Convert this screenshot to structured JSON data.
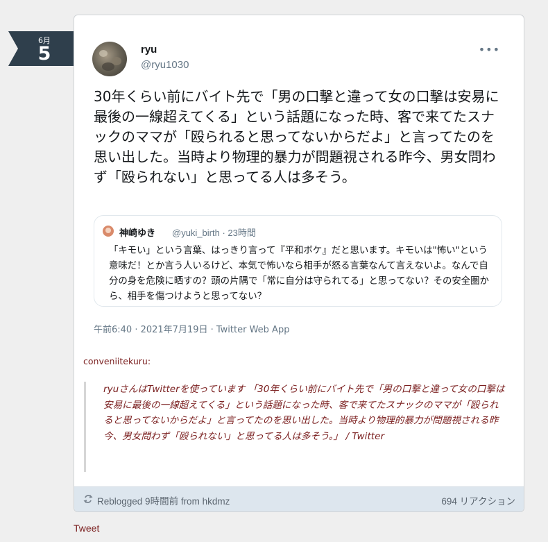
{
  "date": {
    "month": "6月",
    "day": "5"
  },
  "embed": {
    "user_name": "ryu",
    "user_handle": "@ryu1030",
    "more_label": "•••",
    "text": "30年くらい前にバイト先で「男の口撃と違って女の口撃は安易に最後の一線超えてくる」という話題になった時、客で来てたスナックのママが「殴られると思ってないからだよ」と言ってたのを思い出した。当時より物理的暴力が問題視される昨今、男女問わず「殴られない」と思ってる人は多そう。",
    "quote": {
      "name": "神崎ゆき",
      "meta": "@yuki_birth · 23時間",
      "text": "「キモい」という言葉、はっきり言って『平和ボケ』だと思います。キモいは\"怖い\"という意味だ！とか言う人いるけど、本気で怖いなら相手が怒る言葉なんて言えないよ。なんで自分の身を危険に晒すの？頭の片隅で「常に自分は守られてる」と思ってない？その安全圏から、相手を傷つけようと思ってない？"
    },
    "timestamp": "午前6:40 · 2021年7月19日 · Twitter Web App"
  },
  "post": {
    "reblog_user": "conveniitekuru:",
    "quote_text": "ryuさんはTwitterを使っています 「30年くらい前にバイト先で「男の口撃と違って女の口撃は安易に最後の一線超えてくる」という話題になった時、客で来てたスナックのママが「殴られると思ってないからだよ」と言ってたのを思い出した。当時より物理的暴力が問題視される昨今、男女問わず「殴られない」と思ってる人は多そう。」 / Twitter"
  },
  "footer": {
    "reblog_label": "Reblogged 9時間前 from hkdmz",
    "notes": "694 リアクション"
  },
  "tweet_link": "Tweet",
  "colors": {
    "ribbon": "#2f3f4c",
    "link": "#7a1e1e",
    "footer_bg": "#dde6ee"
  }
}
